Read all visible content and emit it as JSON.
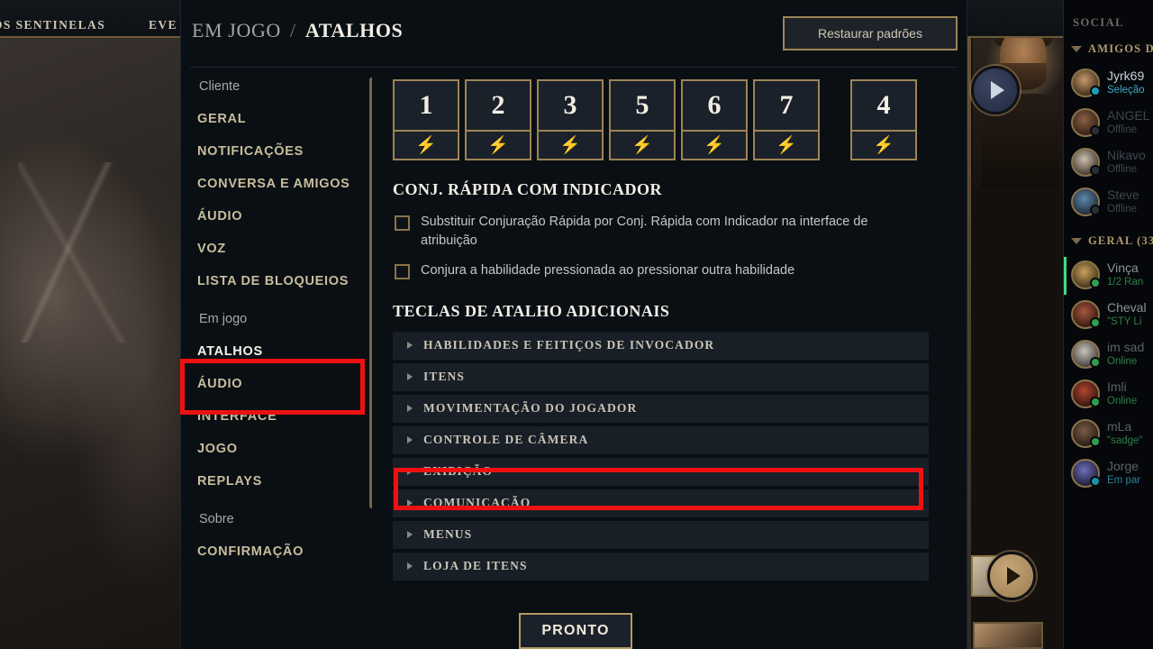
{
  "background": {
    "nav_left": "OS SENTINELAS",
    "nav_right": "EVE"
  },
  "modal": {
    "breadcrumb": {
      "parent": "EM JOGO",
      "separator": "/",
      "current": "ATALHOS"
    },
    "restore_button": "Restaurar padrões",
    "ready_button": "PRONTO"
  },
  "sidebar": {
    "groups": [
      {
        "label": "Cliente",
        "items": [
          {
            "label": "GERAL",
            "selected": false
          },
          {
            "label": "NOTIFICAÇÕES",
            "selected": false
          },
          {
            "label": "CONVERSA E AMIGOS",
            "selected": false
          },
          {
            "label": "ÁUDIO",
            "selected": false
          },
          {
            "label": "VOZ",
            "selected": false
          },
          {
            "label": "LISTA DE BLOQUEIOS",
            "selected": false
          }
        ]
      },
      {
        "label": "Em jogo",
        "items": [
          {
            "label": "ATALHOS",
            "selected": true
          },
          {
            "label": "ÁUDIO",
            "selected": false
          },
          {
            "label": "INTERFACE",
            "selected": false
          },
          {
            "label": "JOGO",
            "selected": false
          },
          {
            "label": "REPLAYS",
            "selected": false
          }
        ]
      },
      {
        "label": "Sobre",
        "items": [
          {
            "label": "CONFIRMAÇÃO",
            "selected": false
          }
        ]
      }
    ]
  },
  "content": {
    "keybinds": [
      {
        "key": "1",
        "icon": "lightning-bolt-icon"
      },
      {
        "key": "2",
        "icon": "lightning-bolt-icon"
      },
      {
        "key": "3",
        "icon": "lightning-bolt-icon"
      },
      {
        "key": "5",
        "icon": "lightning-bolt-icon"
      },
      {
        "key": "6",
        "icon": "lightning-bolt-icon"
      },
      {
        "key": "7",
        "icon": "lightning-bolt-icon"
      }
    ],
    "keybinds_extra": [
      {
        "key": "4",
        "icon": "lightning-bolt-icon"
      }
    ],
    "bolt_glyph": "⚡",
    "quickcast_section": {
      "title": "CONJ. RÁPIDA COM INDICADOR",
      "checkboxes": [
        {
          "label": "Substituir Conjuração Rápida por Conj. Rápida com Indicador na interface de atribuição",
          "checked": false
        },
        {
          "label": "Conjura a habilidade pressionada ao pressionar outra habilidade",
          "checked": false
        }
      ]
    },
    "hotkeys_section": {
      "title": "TECLAS DE ATALHO ADICIONAIS",
      "items": [
        {
          "label": "HABILIDADES E FEITIÇOS DE INVOCADOR",
          "expanded": false,
          "highlighted": false
        },
        {
          "label": "ITENS",
          "expanded": false,
          "highlighted": false
        },
        {
          "label": "MOVIMENTAÇÃO DO JOGADOR",
          "expanded": false,
          "highlighted": false
        },
        {
          "label": "CONTROLE DE CÂMERA",
          "expanded": false,
          "highlighted": false
        },
        {
          "label": "EXIBIÇÃO",
          "expanded": false,
          "highlighted": true
        },
        {
          "label": "COMUNICAÇÃO",
          "expanded": false,
          "highlighted": false
        },
        {
          "label": "MENUS",
          "expanded": false,
          "highlighted": false
        },
        {
          "label": "LOJA DE ITENS",
          "expanded": false,
          "highlighted": false
        }
      ]
    }
  },
  "social": {
    "title": "SOCIAL",
    "groups": [
      {
        "label": "AMIGOS D"
      },
      {
        "label": "GERAL (33"
      }
    ],
    "friends_online_group": [
      {
        "name": "Jyrk69",
        "status": "Seleção",
        "state": "ingame"
      },
      {
        "name": "ANGEL",
        "status": "Offline",
        "state": "offline"
      },
      {
        "name": "Nikavo",
        "status": "Offline",
        "state": "offline"
      },
      {
        "name": "Steve",
        "status": "Offline",
        "state": "offline"
      }
    ],
    "friends_general_group": [
      {
        "name": "Vinça",
        "status": "1/2 Ran",
        "state": "ingame"
      },
      {
        "name": "Cheval",
        "status": "\"STY Li",
        "state": "online"
      },
      {
        "name": "im sad",
        "status": "Online",
        "state": "online"
      },
      {
        "name": "Imli",
        "status": "Online",
        "state": "online"
      },
      {
        "name": "mLa",
        "status": "\"sadge\"",
        "state": "online"
      },
      {
        "name": "Jorge",
        "status": "Em par",
        "state": "party"
      }
    ]
  },
  "annotations": {
    "accent_color": "#ee1111",
    "targets": [
      "sidebar-item-atalhos",
      "hotkey-group-exibicao"
    ]
  }
}
